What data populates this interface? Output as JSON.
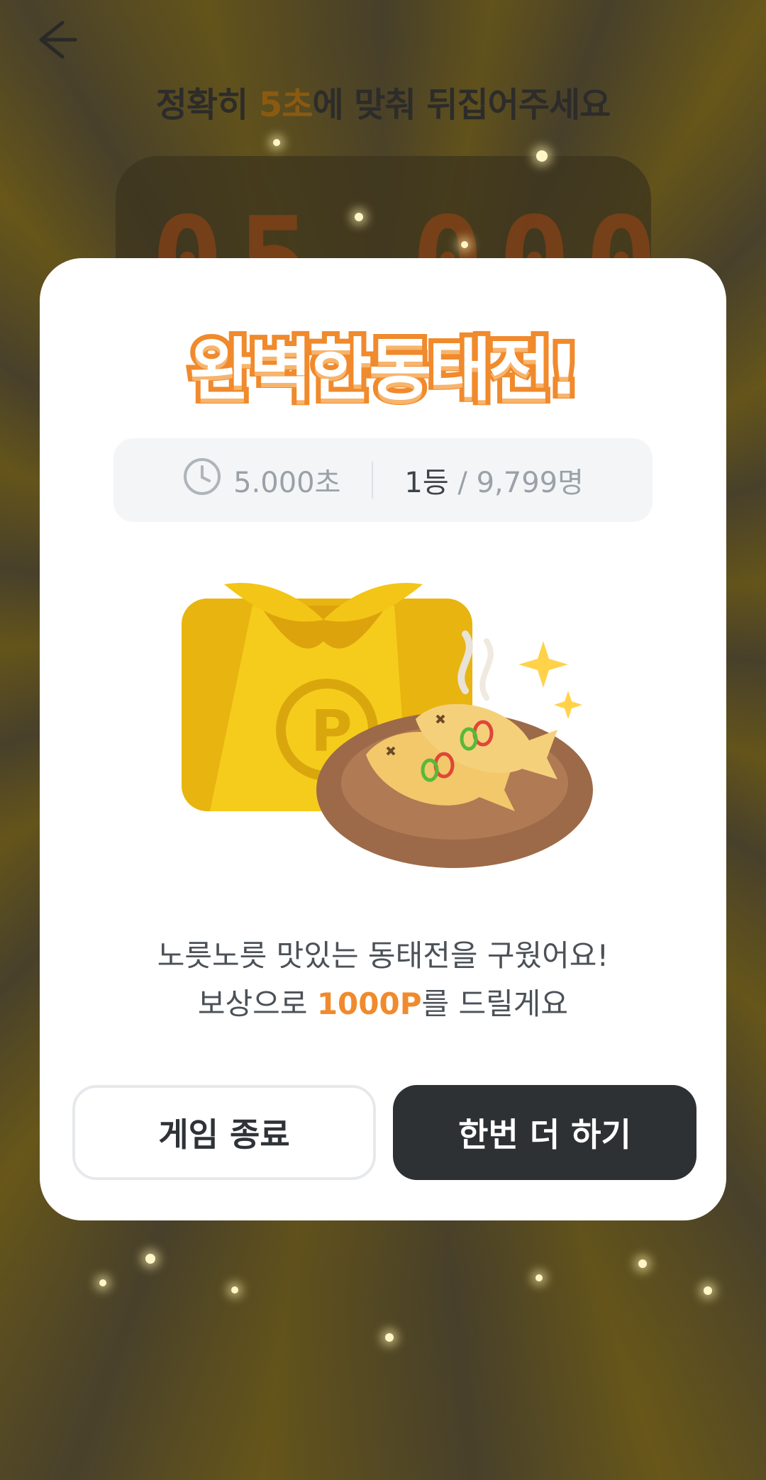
{
  "header": {
    "back_icon": "arrow-left-icon",
    "instruction_prefix": "정확히 ",
    "instruction_highlight": "5초",
    "instruction_suffix": "에 맞춰 뒤집어주세요"
  },
  "timer": {
    "display": "05.000"
  },
  "dialog": {
    "title": "완벽한동태전!",
    "time_icon": "clock-icon",
    "time_value": "5.000초",
    "rank": "1등",
    "rank_separator": " / ",
    "participants": "9,799명",
    "illustration": "gift-box-and-fish-pancake",
    "description_line1": "노릇노릇 맛있는 동태전을 구웠어요!",
    "description_line2_prefix": "보상으로 ",
    "reward_points": "1000P",
    "description_line2_suffix": "를 드릴게요",
    "quit_label": "게임 종료",
    "retry_label": "한번 더 하기"
  },
  "colors": {
    "accent": "#f08a2c",
    "button_dark": "#2d3134",
    "stats_bg": "#f3f5f7"
  }
}
